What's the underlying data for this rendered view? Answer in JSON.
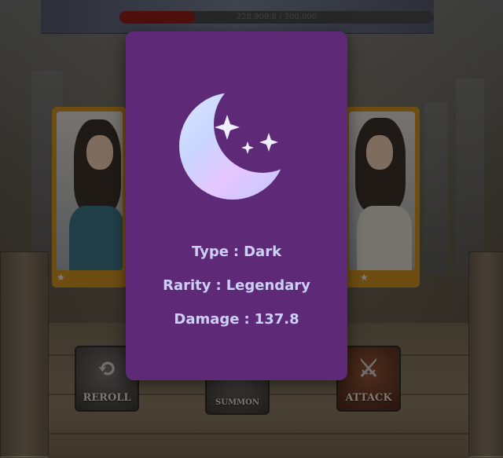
{
  "boss": {
    "hp_current": "228,909.8",
    "hp_max": "300,000",
    "hp_text": "228,909.8 / 300,000",
    "hp_fraction": 0.24,
    "hp_color": "#8a1010"
  },
  "side_cards": [
    {
      "name": "left-character-card",
      "star": "★"
    },
    {
      "name": "right-character-card",
      "star": "★"
    }
  ],
  "actions": {
    "reroll_label": "REROLL",
    "summon_label": "SUMMON",
    "attack_label": "ATTACK"
  },
  "card_popup": {
    "icon": "crescent-moon-icon",
    "background": "#5e2a78",
    "type_label": "Type",
    "type_value": "Dark",
    "rarity_label": "Rarity",
    "rarity_value": "Legendary",
    "damage_label": "Damage",
    "damage_value": "137.8",
    "separator": ":"
  }
}
